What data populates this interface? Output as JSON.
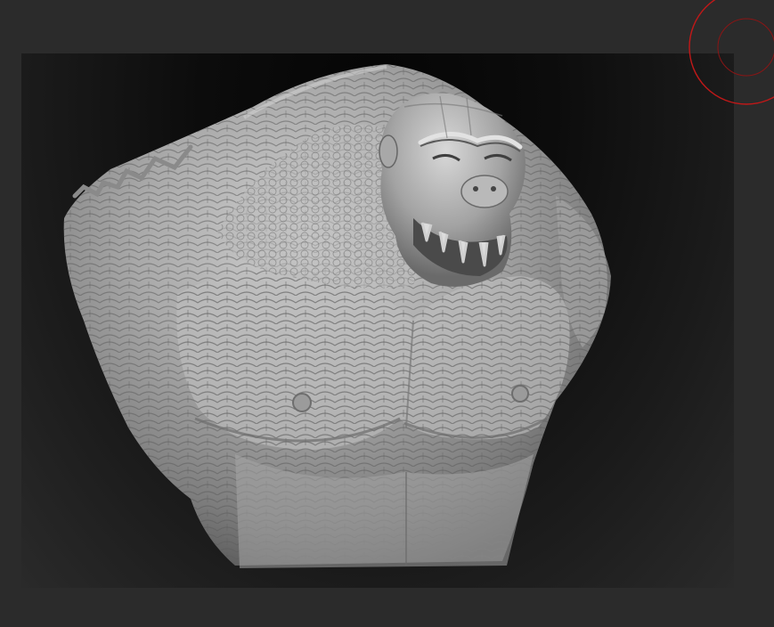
{
  "viewport": {
    "background_color": "#2b2b2b",
    "document_gradient": [
      "#050505",
      "#2a2a2a"
    ],
    "model": {
      "icon": "creature-bust-model",
      "material_color": "#b4b4b4"
    },
    "brush_cursor": {
      "icon": "brush-circle-icon",
      "color": "#c01818"
    }
  }
}
